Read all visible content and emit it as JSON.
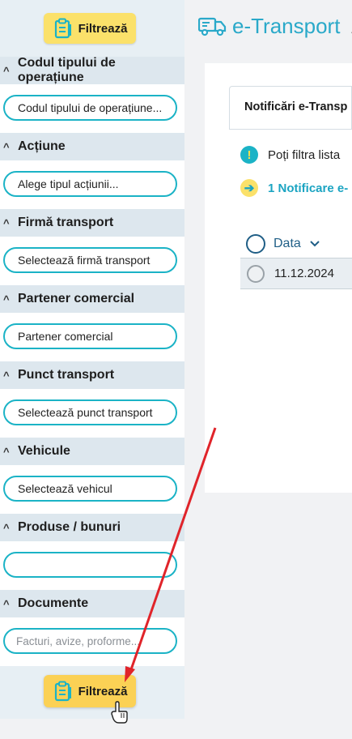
{
  "sidebar": {
    "filter_button_label": "Filtrează",
    "sections": [
      {
        "title": "Codul tipului de operațiune",
        "field": "Codul tipului de operațiune...",
        "placeholder_style": false
      },
      {
        "title": "Acțiune",
        "field": "Alege tipul acțiunii...",
        "placeholder_style": false
      },
      {
        "title": "Firmă transport",
        "field": "Selectează firmă transport",
        "placeholder_style": false
      },
      {
        "title": "Partener comercial",
        "field": "Partener comercial",
        "placeholder_style": false
      },
      {
        "title": "Punct transport",
        "field": "Selectează punct transport",
        "placeholder_style": false
      },
      {
        "title": "Vehicule",
        "field": "Selectează vehicul",
        "placeholder_style": false
      },
      {
        "title": "Produse / bunuri",
        "field": "",
        "placeholder_style": false
      },
      {
        "title": "Documente",
        "field": "Facturi, avize, proforme...",
        "placeholder_style": true
      }
    ]
  },
  "header": {
    "brand": "e-Transport",
    "separator": "/"
  },
  "main": {
    "tab_label": "Notificări e-Transp",
    "info_text": "Poți filtra lista",
    "notification_text": "1 Notificare e-",
    "table": {
      "column_header": "Data",
      "rows": [
        {
          "date": "11.12.2024"
        }
      ]
    }
  },
  "colors": {
    "accent": "#1bb3c6",
    "brand": "#2aa9c9",
    "highlight": "#fbe16a",
    "annotation_arrow": "#e0242a"
  }
}
